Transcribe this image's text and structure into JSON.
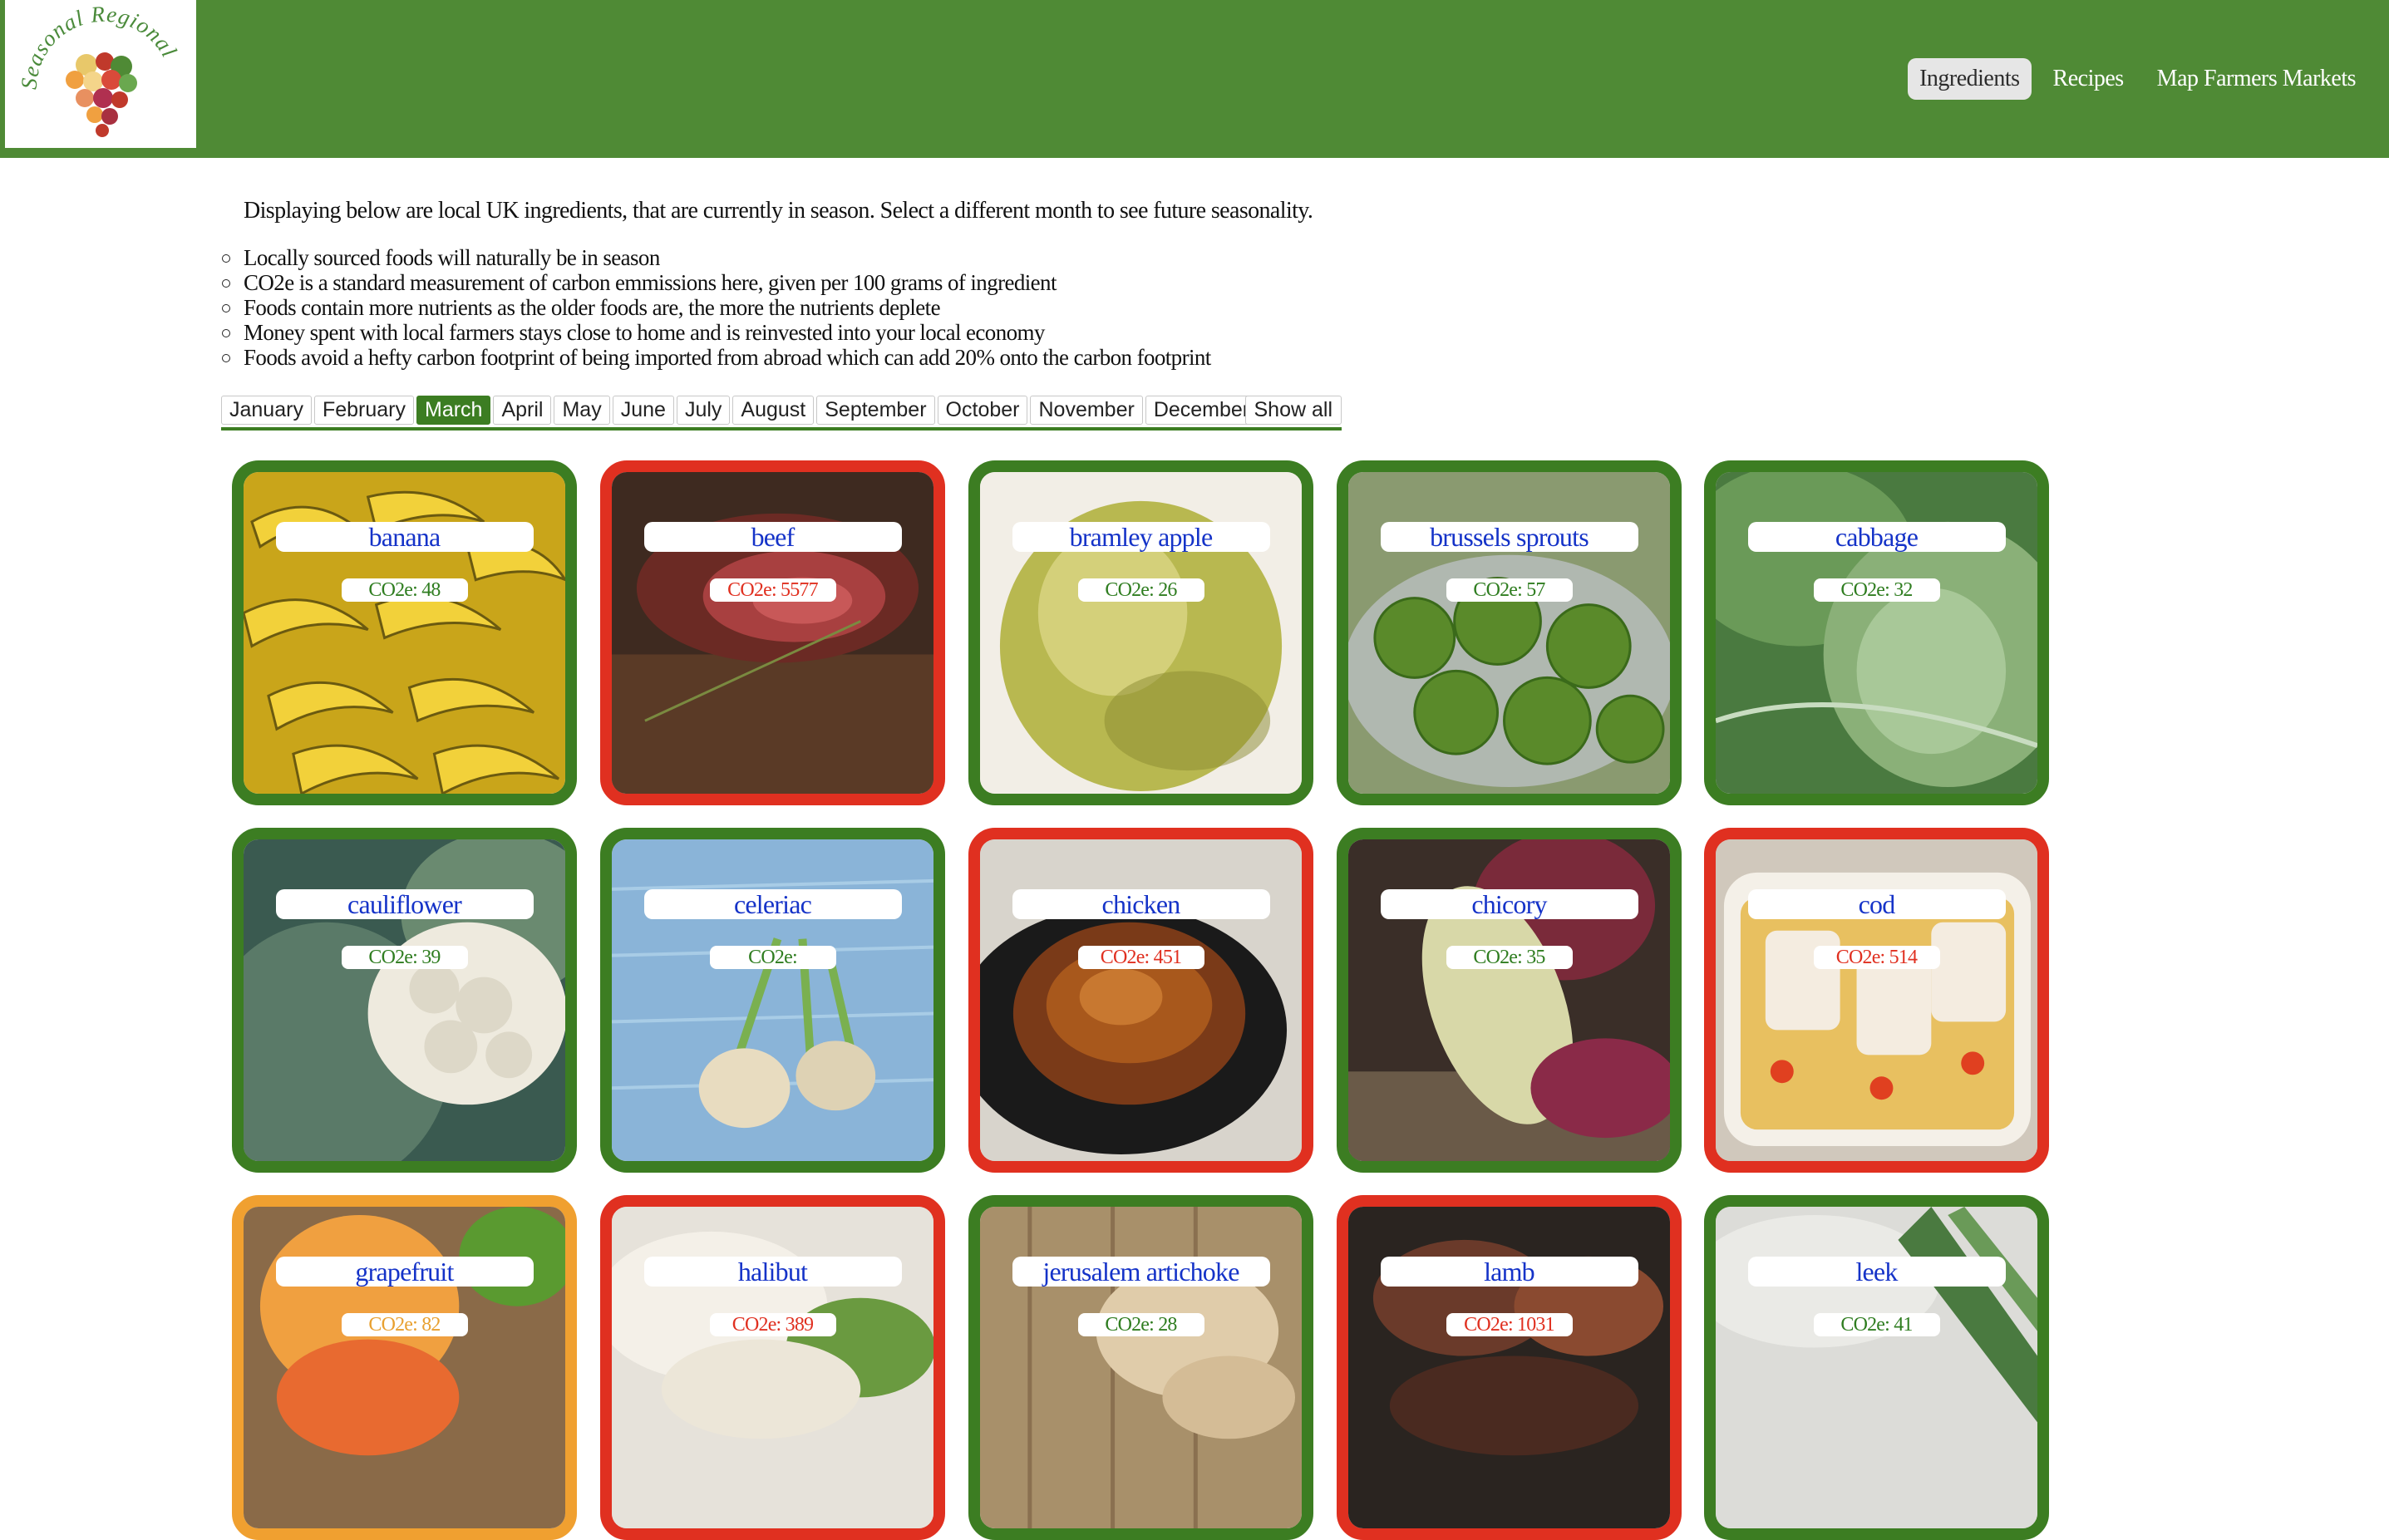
{
  "header": {
    "logo_text": "Seasonal Regional",
    "nav": [
      {
        "label": "Ingredients",
        "active": true
      },
      {
        "label": "Recipes",
        "active": false
      },
      {
        "label": "Map Farmers Markets",
        "active": false
      }
    ],
    "bg_color": "#4f8a35"
  },
  "intro": {
    "text": "Displaying below are local UK ingredients, that are currently in season. Select a different month to see future seasonality.",
    "bullets": [
      "Locally sourced foods will naturally be in season",
      "CO2e is a standard measurement of carbon emmissions here, given per 100 grams of ingredient",
      "Foods contain more nutrients as the older foods are, the more the nutrients deplete",
      "Money spent with local farmers stays close to home and is reinvested into your local economy",
      "Foods avoid a hefty carbon footprint of being imported from abroad which can add 20% onto the carbon footprint"
    ]
  },
  "months": {
    "tabs": [
      "January",
      "February",
      "March",
      "April",
      "May",
      "June",
      "July",
      "August",
      "September",
      "October",
      "November",
      "December"
    ],
    "selected": "March",
    "show_all_label": "Show all",
    "accent_color": "#3c7d22"
  },
  "ingredients": [
    {
      "name": "banana",
      "co2": "CO2e: 48",
      "level": "green",
      "image": "bananas"
    },
    {
      "name": "beef",
      "co2": "CO2e: 5577",
      "level": "red",
      "image": "beef"
    },
    {
      "name": "bramley apple",
      "co2": "CO2e: 26",
      "level": "green",
      "image": "apple"
    },
    {
      "name": "brussels sprouts",
      "co2": "CO2e: 57",
      "level": "green",
      "image": "sprouts"
    },
    {
      "name": "cabbage",
      "co2": "CO2e: 32",
      "level": "green",
      "image": "cabbage"
    },
    {
      "name": "cauliflower",
      "co2": "CO2e: 39",
      "level": "green",
      "image": "cauliflower"
    },
    {
      "name": "celeriac",
      "co2": "CO2e:",
      "level": "green",
      "image": "celeriac"
    },
    {
      "name": "chicken",
      "co2": "CO2e: 451",
      "level": "red",
      "image": "chicken"
    },
    {
      "name": "chicory",
      "co2": "CO2e: 35",
      "level": "green",
      "image": "chicory"
    },
    {
      "name": "cod",
      "co2": "CO2e: 514",
      "level": "red",
      "image": "cod"
    },
    {
      "name": "grapefruit",
      "co2": "CO2e: 82",
      "level": "orange",
      "image": "grapefruit"
    },
    {
      "name": "halibut",
      "co2": "CO2e: 389",
      "level": "red",
      "image": "halibut"
    },
    {
      "name": "jerusalem artichoke",
      "co2": "CO2e: 28",
      "level": "green",
      "image": "artichoke"
    },
    {
      "name": "lamb",
      "co2": "CO2e: 1031",
      "level": "red",
      "image": "lamb"
    },
    {
      "name": "leek",
      "co2": "CO2e: 41",
      "level": "green",
      "image": "leek"
    }
  ],
  "colors": {
    "green": "#3c7d22",
    "red": "#e03020",
    "orange": "#f0a030",
    "name_text": "#1533c8"
  }
}
